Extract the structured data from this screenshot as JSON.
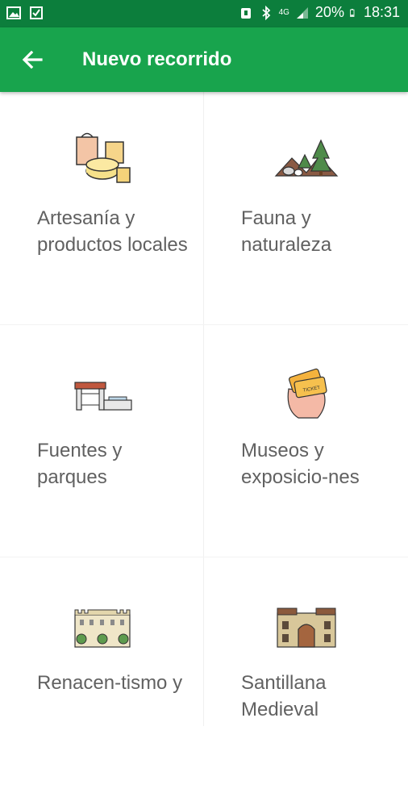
{
  "status_bar": {
    "battery": "20%",
    "time": "18:31",
    "network": "4G"
  },
  "app_bar": {
    "title": "Nuevo recorrido"
  },
  "categories": [
    {
      "label": "Artesanía y productos locales",
      "icon": "cheese-and-bag-icon"
    },
    {
      "label": "Fauna y naturaleza",
      "icon": "trees-and-animals-icon"
    },
    {
      "label": "Fuentes y parques",
      "icon": "fountain-park-icon"
    },
    {
      "label": "Museos y exposicio-nes",
      "icon": "tickets-hand-icon"
    },
    {
      "label": "Renacen-tismo y",
      "icon": "renaissance-palace-icon"
    },
    {
      "label": "Santillana Medieval",
      "icon": "medieval-building-icon"
    }
  ],
  "colors": {
    "status_bar": "#0c7e3c",
    "app_bar": "#18a44d",
    "label_text": "#616161"
  }
}
